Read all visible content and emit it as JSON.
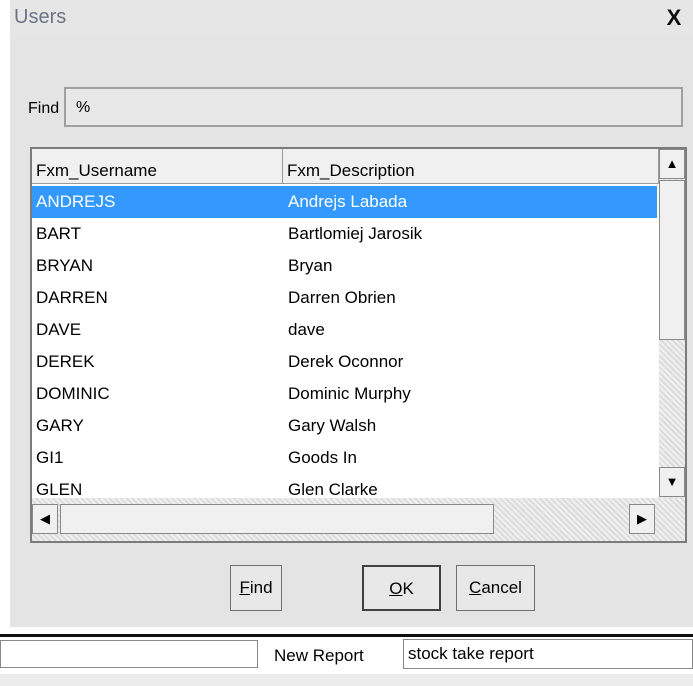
{
  "window": {
    "title": "Users",
    "close_glyph": "X"
  },
  "find": {
    "label": "Find",
    "value": "%"
  },
  "grid": {
    "columns": [
      "Fxm_Username",
      "Fxm_Description"
    ],
    "rows": [
      {
        "username": "ANDREJS",
        "description": "Andrejs Labada"
      },
      {
        "username": "BART",
        "description": "Bartlomiej Jarosik"
      },
      {
        "username": "BRYAN",
        "description": "Bryan"
      },
      {
        "username": "DARREN",
        "description": "Darren Obrien"
      },
      {
        "username": "DAVE",
        "description": "dave"
      },
      {
        "username": "DEREK",
        "description": "Derek Oconnor"
      },
      {
        "username": "DOMINIC",
        "description": "Dominic Murphy"
      },
      {
        "username": "GARY",
        "description": "Gary Walsh"
      },
      {
        "username": "GI1",
        "description": "Goods In"
      },
      {
        "username": "GLEN",
        "description": "Glen Clarke"
      }
    ],
    "selected_row": 0,
    "selection_color": "#3399ff"
  },
  "buttons": {
    "find": {
      "underline": "F",
      "rest": "ind"
    },
    "ok": {
      "underline": "O",
      "rest": "K"
    },
    "cancel": {
      "underline": "C",
      "rest": "ancel"
    }
  },
  "background_form": {
    "new_report_label": "New Report",
    "new_report_value": "stock take report"
  }
}
